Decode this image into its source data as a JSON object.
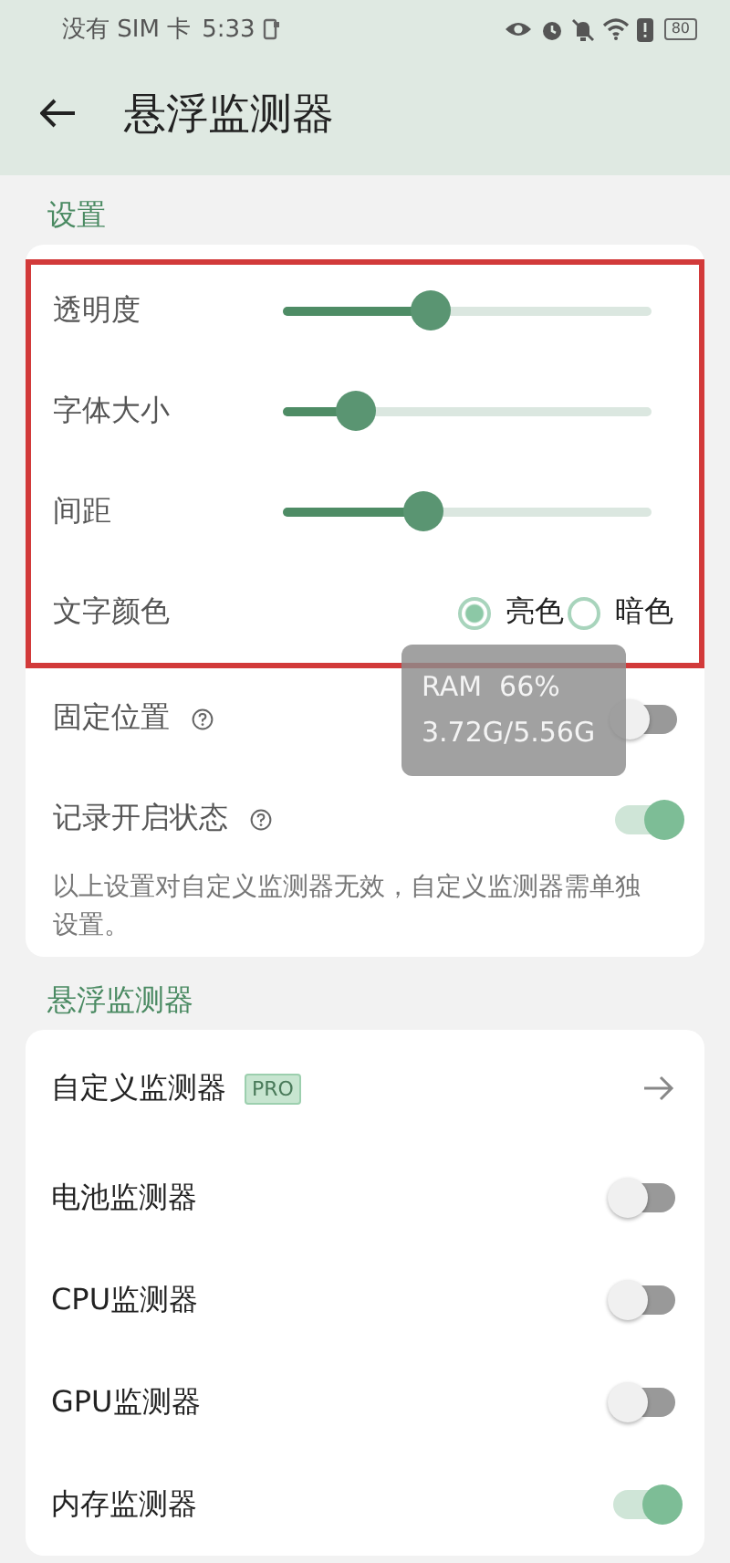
{
  "status_bar": {
    "carrier": "没有 SIM 卡",
    "time": "5:33",
    "battery": "80"
  },
  "header": {
    "title": "悬浮监测器"
  },
  "settings": {
    "title": "设置",
    "highlighted": true,
    "sliders": [
      {
        "label": "透明度",
        "level": 0.4
      },
      {
        "label": "字体大小",
        "level": 0.2
      },
      {
        "label": "间距",
        "level": 0.38
      }
    ],
    "text_color": {
      "label": "文字颜色",
      "options": [
        {
          "label": "亮色",
          "selected": true
        },
        {
          "label": "暗色",
          "selected": false
        }
      ]
    },
    "toggles": [
      {
        "label": "固定位置",
        "help": true,
        "on": false
      },
      {
        "label": "记录开启状态",
        "help": true,
        "on": true
      }
    ],
    "note": "以上设置对自定义监测器无效，自定义监测器需单独设置。"
  },
  "overlay": {
    "line_1": "RAM  66%",
    "line_2": "3.72G/5.56G"
  },
  "monitors": {
    "title": "悬浮监测器",
    "items": [
      {
        "kind": "link",
        "label": "自定义监测器",
        "badge": "PRO"
      },
      {
        "kind": "toggle",
        "label": "电池监测器",
        "on": false
      },
      {
        "kind": "toggle",
        "label": "CPU监测器",
        "on": false
      },
      {
        "kind": "toggle",
        "label": "GPU监测器",
        "on": false
      },
      {
        "kind": "toggle",
        "label": "内存监测器",
        "on": true
      }
    ]
  }
}
